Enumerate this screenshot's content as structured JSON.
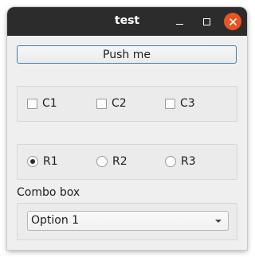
{
  "window": {
    "title": "test"
  },
  "push_button": {
    "label": "Push me"
  },
  "checkboxes": [
    {
      "label": "C1",
      "checked": false
    },
    {
      "label": "C2",
      "checked": false
    },
    {
      "label": "C3",
      "checked": false
    }
  ],
  "radios": [
    {
      "label": "R1",
      "selected": true
    },
    {
      "label": "R2",
      "selected": false
    },
    {
      "label": "R3",
      "selected": false
    }
  ],
  "combo": {
    "label": "Combo box",
    "selected": "Option 1"
  },
  "colors": {
    "titlebar": "#2c2c2c",
    "close_button": "#e95420",
    "focus_border": "#3e7fb6",
    "window_bg": "#efefef"
  },
  "icons": {
    "minimize": "minimize-icon",
    "maximize": "maximize-icon",
    "close": "close-icon",
    "dropdown": "chevron-down-icon"
  }
}
